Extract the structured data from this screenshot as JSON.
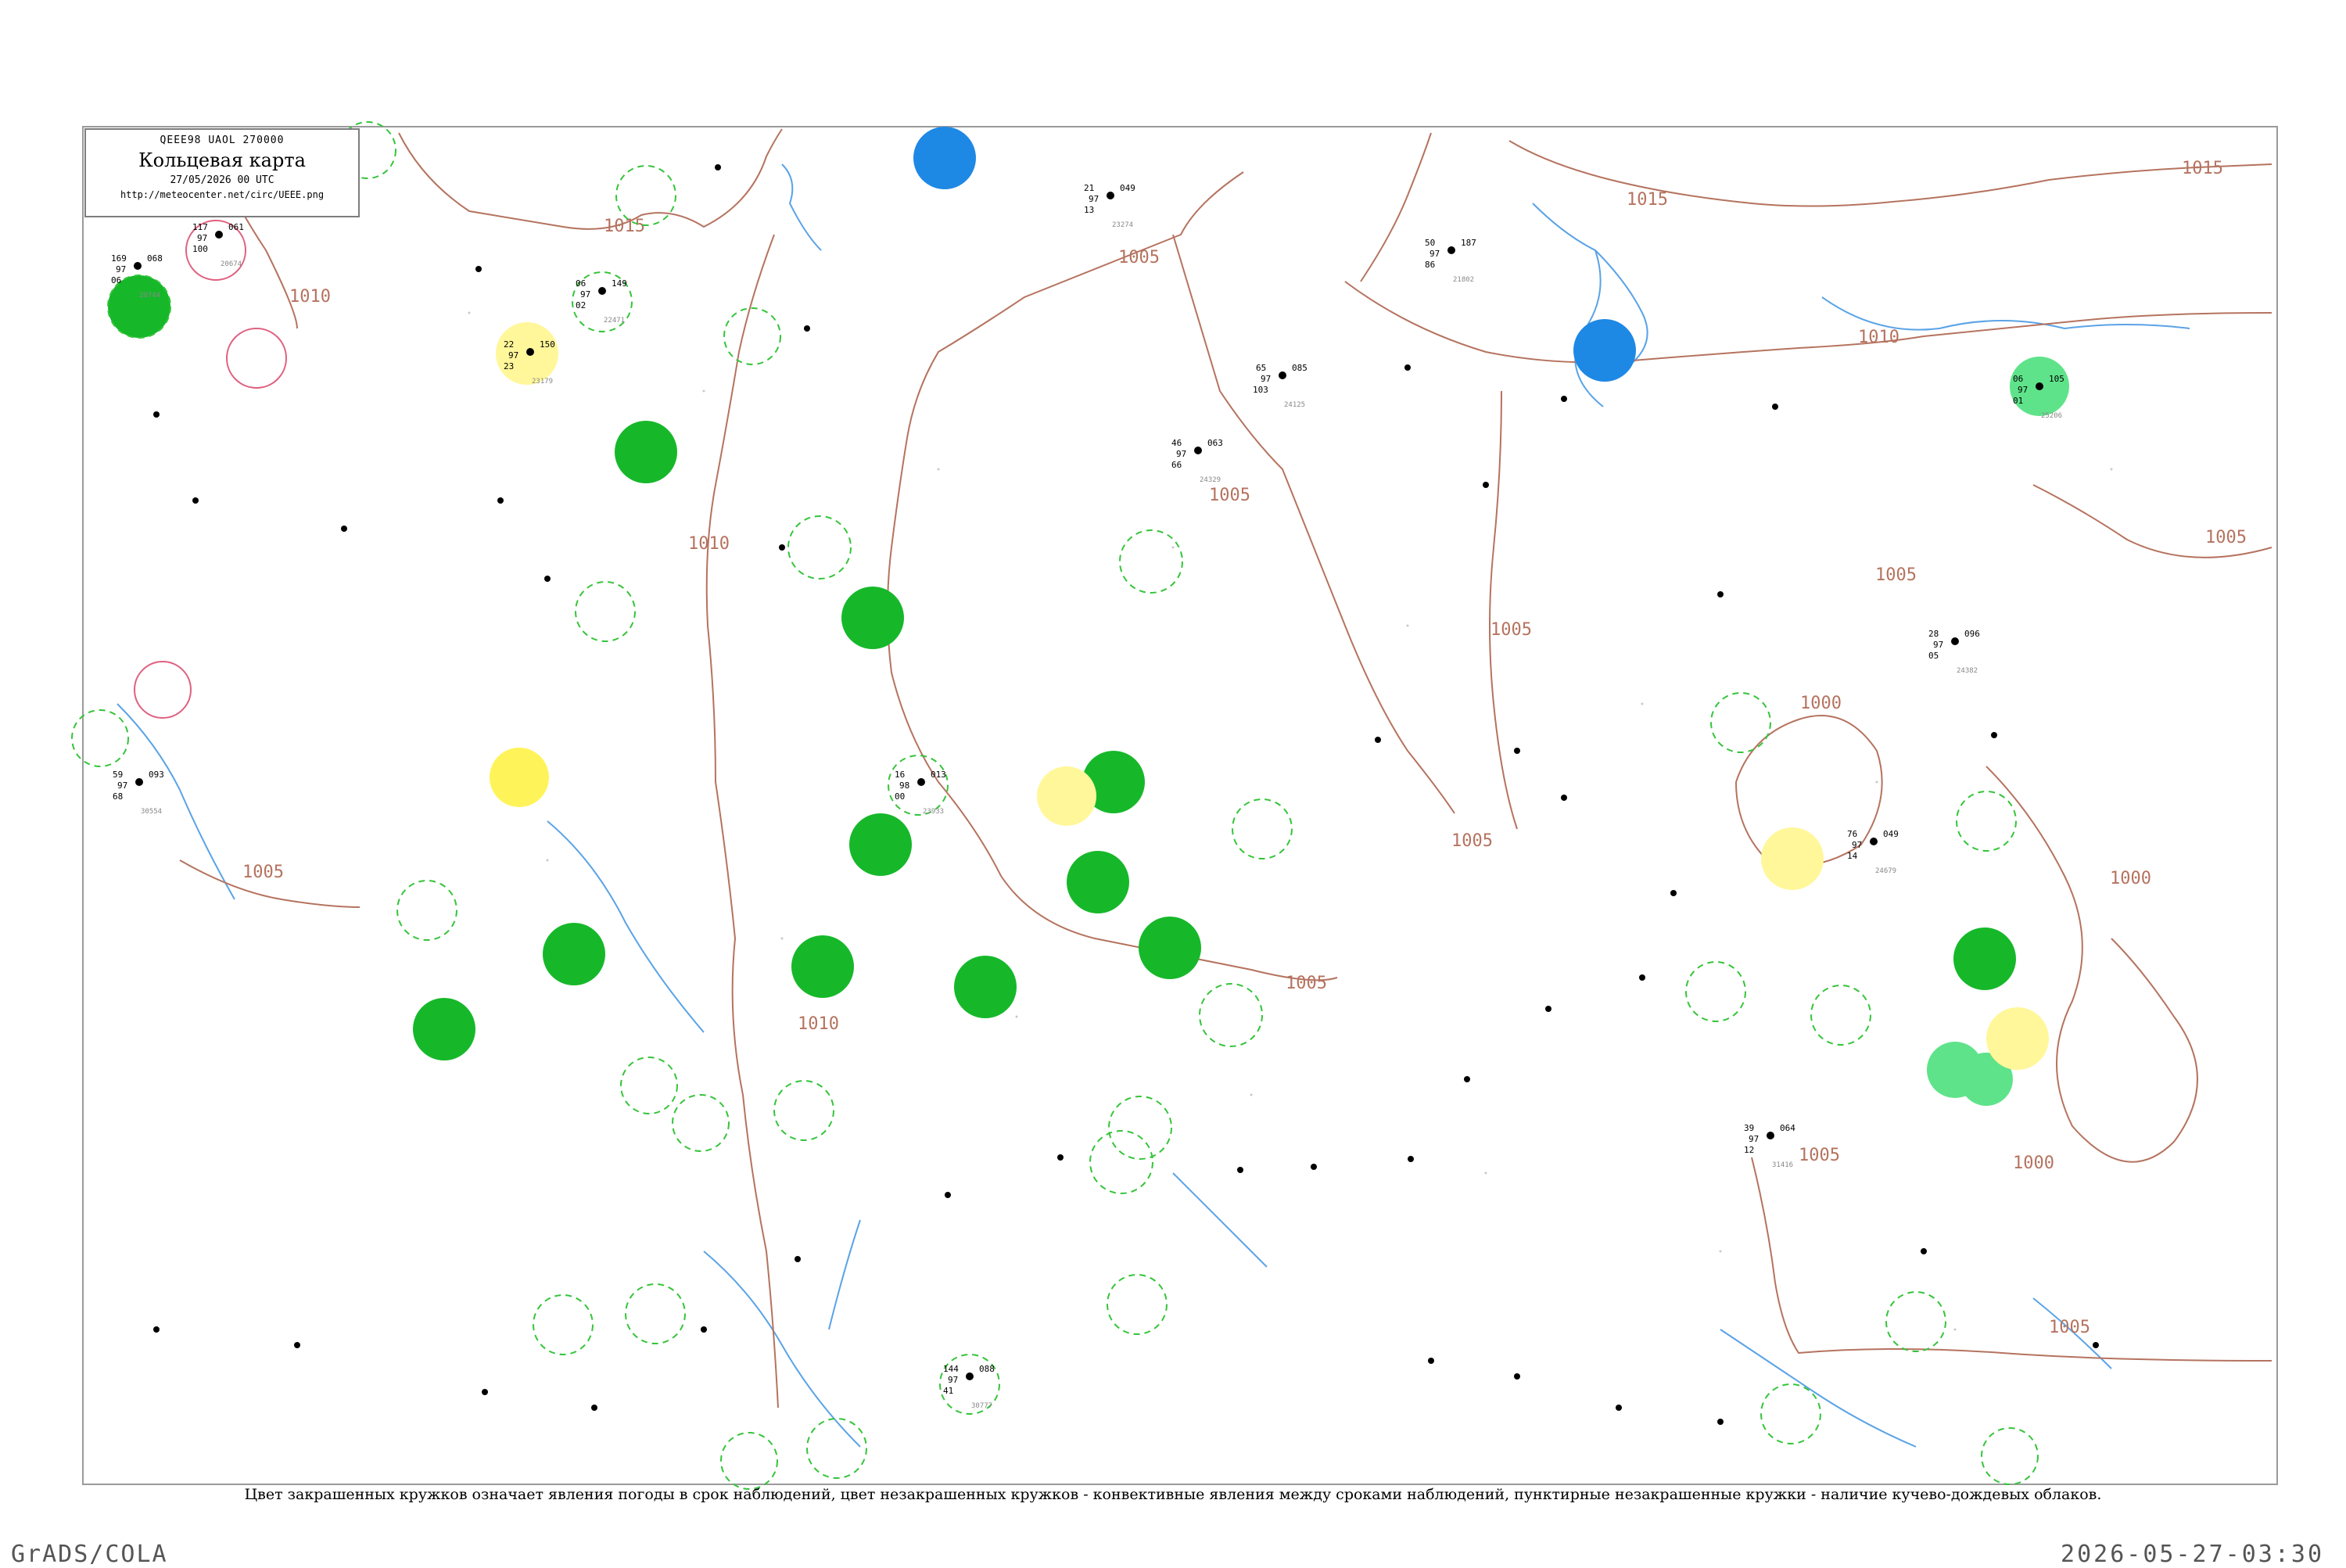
{
  "legend": {
    "code_line": "QEEE98  UAOL  270000",
    "title": "Кольцевая карта",
    "date": "27/05/2026 00 UTC",
    "url": "http://meteocenter.net/circ/UEEE.png"
  },
  "footnote": "Цвет закрашенных кружков означает явления погоды в срок наблюдений, цвет незакрашенных кружков - конвективные явления между сроками наблюдений, пунктирные незакрашенные кружки - наличие кучево-дождевых облаков.",
  "footer": {
    "left": "GrADS/COLA",
    "right": "2026-05-27-03:30"
  },
  "colors": {
    "isobar": "#b5735f",
    "river": "#5aa3e6",
    "station_dot": "#000000",
    "cb_ring": "#35c43a",
    "filled_green": "#16b82a",
    "filled_blue": "#1e88e5",
    "filled_yellow": "#fff35a",
    "filled_lightyellow": "#fff79a",
    "thunder_ring": "#e06080"
  },
  "isobar_labels": [
    "1015",
    "1010",
    "1005",
    "1000"
  ],
  "stations": [
    {
      "id": "20674",
      "label": "117",
      "p": "061",
      "t": "97",
      "d": "100"
    },
    {
      "id": "20744",
      "label": "169",
      "p": "068",
      "t": "97",
      "d": "06"
    },
    {
      "id": "23179",
      "label": "150",
      "p": "22",
      "t": "97",
      "d": "23"
    },
    {
      "id": "22471",
      "label": "149",
      "p": "06",
      "t": "97",
      "d": "02"
    },
    {
      "id": "23274",
      "label": "21",
      "p": "049",
      "t": "97",
      "d": "13"
    },
    {
      "id": "21802",
      "label": "50",
      "p": "187",
      "t": "97",
      "d": "86"
    },
    {
      "id": "24125",
      "label": "65",
      "p": "085",
      "t": "97",
      "d": "103"
    },
    {
      "id": "23933",
      "label": "16",
      "p": "013",
      "t": "98",
      "d": "00"
    },
    {
      "id": "24329",
      "label": "46",
      "p": "063",
      "t": "97",
      "d": "66"
    },
    {
      "id": "24382",
      "label": "28",
      "p": "096",
      "t": "97",
      "d": "05"
    },
    {
      "id": "24679",
      "label": "76",
      "p": "049",
      "t": "97",
      "d": "14"
    },
    {
      "id": "25206",
      "label": "06",
      "p": "105",
      "t": "97",
      "d": "01"
    },
    {
      "id": "31416",
      "label": "39",
      "p": "064",
      "t": "97",
      "d": "12"
    },
    {
      "id": "30554",
      "label": "59",
      "p": "093",
      "t": "97",
      "d": "68"
    },
    {
      "id": "30777",
      "label": "144",
      "p": "088",
      "t": "97",
      "d": "41"
    }
  ]
}
